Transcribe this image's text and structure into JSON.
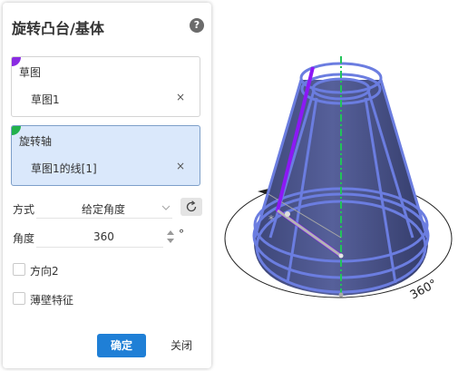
{
  "dialog": {
    "title": "旋转凸台/基体",
    "help_glyph": "?",
    "sketch_section": {
      "label": "草图",
      "value": "草图1",
      "clear_glyph": "×",
      "marker_color": "#8a2be2"
    },
    "axis_section": {
      "label": "旋转轴",
      "value": "草图1的线[1]",
      "clear_glyph": "×",
      "marker_color": "#22b14c"
    },
    "mode": {
      "label": "方式",
      "value": "给定角度"
    },
    "angle": {
      "label": "角度",
      "value": "360",
      "unit": "°"
    },
    "direction2": {
      "label": "方向2",
      "checked": false
    },
    "thin_feature": {
      "label": "薄壁特征",
      "checked": false
    },
    "buttons": {
      "ok": "确定",
      "close": "关闭"
    },
    "accent_color": "#1f7fd6"
  },
  "viewport": {
    "angle_annotation": "360°",
    "colors": {
      "body": "#4a5585",
      "edges": "#6b7de0",
      "profile": "#8c18f5",
      "axis": "#22c35a"
    }
  }
}
